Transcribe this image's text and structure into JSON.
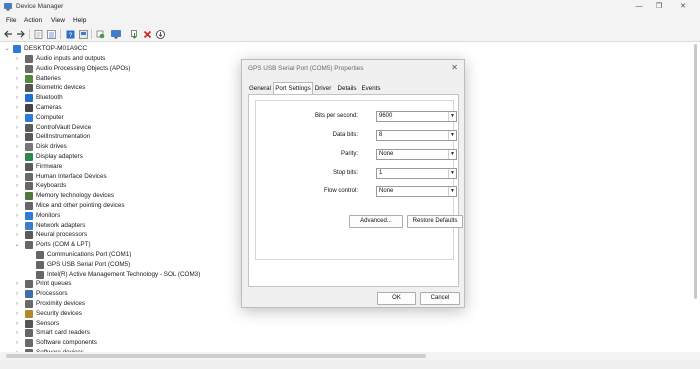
{
  "window": {
    "title": "Device Manager",
    "minimize": "—",
    "maximize": "❐",
    "close": "✕"
  },
  "menu": [
    "File",
    "Action",
    "View",
    "Help"
  ],
  "toolbar_icons": [
    "back-arrow-icon",
    "forward-arrow-icon",
    "properties-sheet-icon",
    "list-view-icon",
    "help-icon",
    "device-panel-icon",
    "refresh-icon",
    "monitor-icon",
    "update-driver-icon",
    "uninstall-x-icon",
    "download-icon"
  ],
  "tree": {
    "root": "DESKTOP-M01A9CC",
    "items": [
      {
        "label": "Audio inputs and outputs",
        "icon": "speaker-icon",
        "color": "#6b6b6b"
      },
      {
        "label": "Audio Processing Objects (APOs)",
        "icon": "speaker-icon",
        "color": "#6b6b6b"
      },
      {
        "label": "Batteries",
        "icon": "battery-icon",
        "color": "#4f8a3a"
      },
      {
        "label": "Biometric devices",
        "icon": "fingerprint-icon",
        "color": "#555555"
      },
      {
        "label": "Bluetooth",
        "icon": "bluetooth-icon",
        "color": "#1f6fd1"
      },
      {
        "label": "Cameras",
        "icon": "camera-icon",
        "color": "#444444"
      },
      {
        "label": "Computer",
        "icon": "computer-icon",
        "color": "#2c7bd6"
      },
      {
        "label": "ControlVault Device",
        "icon": "chip-icon",
        "color": "#5a5a5a"
      },
      {
        "label": "DellInstrumentation",
        "icon": "chip-icon",
        "color": "#5a5a5a"
      },
      {
        "label": "Disk drives",
        "icon": "disk-icon",
        "color": "#777777"
      },
      {
        "label": "Display adapters",
        "icon": "display-adapter-icon",
        "color": "#2d8a4e"
      },
      {
        "label": "Firmware",
        "icon": "firmware-icon",
        "color": "#5a5a5a"
      },
      {
        "label": "Human Interface Devices",
        "icon": "hid-icon",
        "color": "#6a6a6a"
      },
      {
        "label": "Keyboards",
        "icon": "keyboard-icon",
        "color": "#666666"
      },
      {
        "label": "Memory technology devices",
        "icon": "memory-icon",
        "color": "#4d7a3a"
      },
      {
        "label": "Mice and other pointing devices",
        "icon": "mouse-icon",
        "color": "#666666"
      },
      {
        "label": "Monitors",
        "icon": "monitor-icon",
        "color": "#2c7bd6"
      },
      {
        "label": "Network adapters",
        "icon": "network-icon",
        "color": "#3a7fc4"
      },
      {
        "label": "Neural processors",
        "icon": "chip-icon",
        "color": "#5a5a5a"
      },
      {
        "label": "Ports (COM & LPT)",
        "icon": "port-icon",
        "color": "#666666"
      },
      {
        "label": "Communications Port (COM1)",
        "icon": "port-icon",
        "color": "#666666"
      },
      {
        "label": "GPS USB Serial Port (COM5)",
        "icon": "port-icon",
        "color": "#666666"
      },
      {
        "label": "Intel(R) Active Management Technology - SOL (COM3)",
        "icon": "port-icon",
        "color": "#666666"
      },
      {
        "label": "Print queues",
        "icon": "printer-icon",
        "color": "#666666"
      },
      {
        "label": "Processors",
        "icon": "processor-icon",
        "color": "#3f6fa8"
      },
      {
        "label": "Proximity devices",
        "icon": "proximity-icon",
        "color": "#6a6a6a"
      },
      {
        "label": "Security devices",
        "icon": "security-icon",
        "color": "#b08a2e"
      },
      {
        "label": "Sensors",
        "icon": "sensor-icon",
        "color": "#555555"
      },
      {
        "label": "Smart card readers",
        "icon": "smartcard-icon",
        "color": "#666666"
      },
      {
        "label": "Software components",
        "icon": "component-icon",
        "color": "#6a6a6a"
      },
      {
        "label": "Software devices",
        "icon": "component-icon",
        "color": "#6a6a6a"
      }
    ]
  },
  "dialog": {
    "title": "GPS USB Serial Port (COM5) Properties",
    "close": "✕",
    "tabs": [
      "General",
      "Port Settings",
      "Driver",
      "Details",
      "Events"
    ],
    "active_tab": "Port Settings",
    "fields": [
      {
        "label": "Bits per second:",
        "value": "9600"
      },
      {
        "label": "Data bits:",
        "value": "8"
      },
      {
        "label": "Parity:",
        "value": "None"
      },
      {
        "label": "Stop bits:",
        "value": "1"
      },
      {
        "label": "Flow control:",
        "value": "None"
      }
    ],
    "advanced_label": "Advanced...",
    "restore_label": "Restore Defaults",
    "ok_label": "OK",
    "cancel_label": "Cancel"
  }
}
